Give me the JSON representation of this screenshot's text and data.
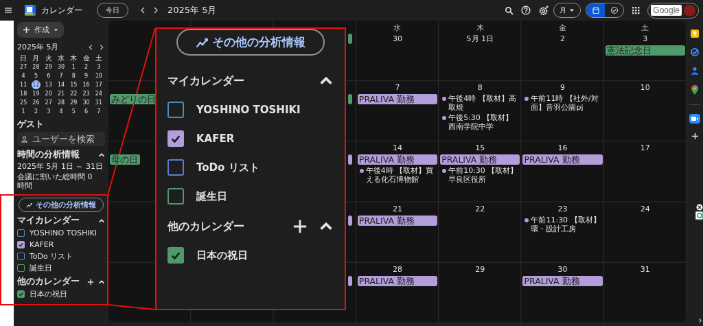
{
  "header": {
    "app_name": "カレンダー",
    "today_button": "今日",
    "month_title": "2025年 5月",
    "view_dropdown": "月",
    "view_toggle": [
      {
        "kind": "calendar",
        "selected": true
      },
      {
        "kind": "tasks",
        "selected": false
      }
    ],
    "account_logo": "Google"
  },
  "sidebar": {
    "create_button": "作成",
    "mini_calendar": {
      "title": "2025年 5月",
      "weekdays": [
        "日",
        "月",
        "火",
        "水",
        "木",
        "金",
        "土"
      ],
      "weeks": [
        [
          {
            "d": "27",
            "selected": false
          },
          {
            "d": "28",
            "selected": false
          },
          {
            "d": "29",
            "selected": false
          },
          {
            "d": "30",
            "selected": false
          },
          {
            "d": "1",
            "selected": false
          },
          {
            "d": "2",
            "selected": false
          },
          {
            "d": "3",
            "selected": false
          }
        ],
        [
          {
            "d": "4",
            "selected": false
          },
          {
            "d": "5",
            "selected": false
          },
          {
            "d": "6",
            "selected": false
          },
          {
            "d": "7",
            "selected": false
          },
          {
            "d": "8",
            "selected": false
          },
          {
            "d": "9",
            "selected": false
          },
          {
            "d": "10",
            "selected": false
          }
        ],
        [
          {
            "d": "11",
            "selected": false
          },
          {
            "d": "12",
            "selected": true
          },
          {
            "d": "13",
            "selected": false
          },
          {
            "d": "14",
            "selected": false
          },
          {
            "d": "15",
            "selected": false
          },
          {
            "d": "16",
            "selected": false
          },
          {
            "d": "17",
            "selected": false
          }
        ],
        [
          {
            "d": "18",
            "selected": false
          },
          {
            "d": "19",
            "selected": false
          },
          {
            "d": "20",
            "selected": false
          },
          {
            "d": "21",
            "selected": false
          },
          {
            "d": "22",
            "selected": false
          },
          {
            "d": "23",
            "selected": false
          },
          {
            "d": "24",
            "selected": false
          }
        ],
        [
          {
            "d": "25",
            "selected": false
          },
          {
            "d": "26",
            "selected": false
          },
          {
            "d": "27",
            "selected": false
          },
          {
            "d": "28",
            "selected": false
          },
          {
            "d": "29",
            "selected": false
          },
          {
            "d": "30",
            "selected": false
          },
          {
            "d": "31",
            "selected": false
          }
        ],
        [
          {
            "d": "1",
            "selected": false
          },
          {
            "d": "2",
            "selected": false
          },
          {
            "d": "3",
            "selected": false
          },
          {
            "d": "4",
            "selected": false
          },
          {
            "d": "5",
            "selected": false
          },
          {
            "d": "6",
            "selected": false
          },
          {
            "d": "7",
            "selected": false
          }
        ]
      ]
    },
    "guests": {
      "title": "ゲスト",
      "placeholder": "ユーザーを検索"
    },
    "time_insights": {
      "title": "時間の分析情報",
      "expanded": true,
      "date_range": "2025年 5月 1日 ～ 31日",
      "meeting_time": "会議に割いた総時間 0 時間",
      "more_button": "その他の分析情報"
    },
    "my_calendars": {
      "title": "マイカレンダー",
      "expanded": true,
      "items": [
        {
          "label": "YOSHINO TOSHIKI",
          "checked": false,
          "color": "#4a8fc4"
        },
        {
          "label": "KAFER",
          "checked": true,
          "color": "#b39ddb"
        },
        {
          "label": "ToDo リスト",
          "checked": false,
          "color": "#5a7fd0"
        },
        {
          "label": "誕生日",
          "checked": false,
          "color": "#4f9a6a"
        }
      ]
    },
    "other_calendars": {
      "title": "他のカレンダー",
      "expanded": true,
      "items": [
        {
          "label": "日本の祝日",
          "checked": true,
          "color": "#4f9a6a"
        }
      ]
    }
  },
  "calendar_grid": {
    "weeks": [
      {
        "cells": [
          {},
          {},
          {
            "events": [
              {
                "kind": "bar",
                "color": "#4f9a6a"
              }
            ]
          },
          {
            "weekday": "水",
            "date": "30"
          },
          {
            "weekday": "木",
            "date": "5月 1日"
          },
          {
            "weekday": "金",
            "date": "2"
          },
          {
            "weekday": "土",
            "date": "3",
            "events": [
              {
                "kind": "bar",
                "color": "#4f9a6a",
                "label": "憲法記念日"
              }
            ]
          }
        ]
      },
      {
        "cells": [
          {
            "events": [
              {
                "kind": "bar",
                "color": "#4f9a6a",
                "label": "みどりの日"
              }
            ]
          },
          {},
          {
            "events": [
              {
                "kind": "bar",
                "color": "#4f9a6a"
              }
            ]
          },
          {
            "date": "7",
            "events": [
              {
                "kind": "bar",
                "color": "#b39ddb",
                "label": "PRALIVA 勤務"
              }
            ]
          },
          {
            "date": "8",
            "events": [
              {
                "kind": "dot",
                "color": "#b39ddb",
                "label": "午後4時 【取材】高取焼"
              },
              {
                "kind": "dot",
                "color": "#b39ddb",
                "label": "午後5:30 【取材】西南学院中学"
              }
            ]
          },
          {
            "date": "9",
            "events": [
              {
                "kind": "dot",
                "color": "#b39ddb",
                "label": "午前11時 【社外/対面】音羽公園pj"
              }
            ]
          },
          {
            "date": "10"
          }
        ]
      },
      {
        "cells": [
          {
            "events": [
              {
                "kind": "bar",
                "color": "#4f9a6a",
                "label": "母の日"
              }
            ]
          },
          {},
          {
            "events": [
              {
                "kind": "bar",
                "color": "#b39ddb"
              }
            ]
          },
          {
            "date": "14",
            "events": [
              {
                "kind": "bar",
                "color": "#b39ddb",
                "label": "PRALIVA 勤務"
              },
              {
                "kind": "dot",
                "color": "#b39ddb",
                "label": "午後4時 【取材】買える化石博物館"
              }
            ]
          },
          {
            "date": "15",
            "events": [
              {
                "kind": "bar",
                "color": "#b39ddb",
                "label": "PRALIVA 勤務"
              },
              {
                "kind": "dot",
                "color": "#b39ddb",
                "label": "午前10:30 【取材】早良区役所"
              }
            ]
          },
          {
            "date": "16",
            "events": [
              {
                "kind": "bar",
                "color": "#b39ddb",
                "label": "PRALIVA 勤務"
              }
            ]
          },
          {
            "date": "17"
          }
        ]
      },
      {
        "cells": [
          {},
          {},
          {
            "events": [
              {
                "kind": "bar",
                "color": "#b39ddb"
              }
            ]
          },
          {
            "date": "21",
            "events": [
              {
                "kind": "bar",
                "color": "#b39ddb",
                "label": "PRALIVA 勤務"
              }
            ]
          },
          {
            "date": "22"
          },
          {
            "date": "23",
            "events": [
              {
                "kind": "dot",
                "color": "#b39ddb",
                "label": "午前11:30 【取材】環・設計工房"
              }
            ]
          },
          {
            "date": "24"
          }
        ]
      },
      {
        "cells": [
          {},
          {},
          {
            "events": [
              {
                "kind": "bar",
                "color": "#b39ddb"
              }
            ]
          },
          {
            "date": "28",
            "events": [
              {
                "kind": "bar",
                "color": "#b39ddb",
                "label": "PRALIVA 勤務"
              }
            ]
          },
          {
            "date": "29"
          },
          {
            "date": "30",
            "events": [
              {
                "kind": "bar",
                "color": "#b39ddb",
                "label": "PRALIVA 勤務"
              }
            ]
          },
          {
            "date": "31"
          }
        ]
      }
    ]
  },
  "zoom_callout": {
    "more_button": "その他の分析情報",
    "my_calendars": {
      "title": "マイカレンダー",
      "expanded": true,
      "items": [
        {
          "label": "YOSHINO TOSHIKI",
          "checked": false,
          "color": "#4a8fc4"
        },
        {
          "label": "KAFER",
          "checked": true,
          "color": "#b39ddb"
        },
        {
          "label": "ToDo リスト",
          "checked": false,
          "color": "#5a7fd0"
        },
        {
          "label": "誕生日",
          "checked": false,
          "color": "#4f9a6a"
        }
      ]
    },
    "other_calendars": {
      "title": "他のカレンダー",
      "expanded": true,
      "items": [
        {
          "label": "日本の祝日",
          "checked": true,
          "color": "#4f9a6a"
        }
      ]
    }
  }
}
